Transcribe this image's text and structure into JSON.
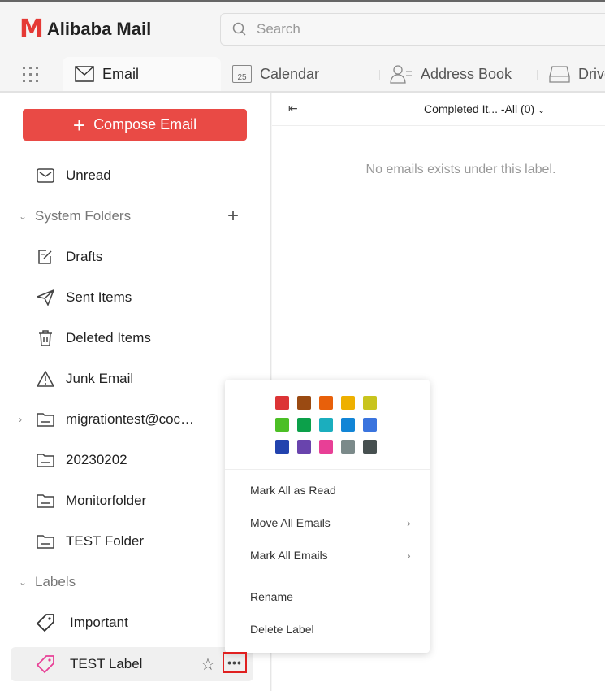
{
  "app": {
    "logo_mark": "M",
    "name": "Alibaba Mail"
  },
  "search": {
    "placeholder": "Search"
  },
  "tabs": [
    {
      "label": "Email"
    },
    {
      "label": "Calendar",
      "day": "25"
    },
    {
      "label": "Address Book"
    },
    {
      "label": "Drive"
    }
  ],
  "sidebar": {
    "compose": "Compose Email",
    "unread": "Unread",
    "system_folders": "System Folders",
    "folders": [
      "Drafts",
      "Sent Items",
      "Deleted Items",
      "Junk Email",
      "migrationtest@coc…",
      "20230202",
      "Monitorfolder",
      "TEST Folder"
    ],
    "labels_header": "Labels",
    "labels": [
      "Important",
      "TEST Label"
    ]
  },
  "main": {
    "filter": "Completed It... -All (0)",
    "empty": "No emails exists under this label."
  },
  "menu": {
    "colors": [
      "#dc3436",
      "#9a4a12",
      "#e8600a",
      "#eeb000",
      "#c8c41e",
      "#4cbf25",
      "#0ca04a",
      "#1baebe",
      "#1285d6",
      "#3a74de",
      "#2243ae",
      "#6944ad",
      "#e83f96",
      "#7b8a8a",
      "#475050"
    ],
    "items": [
      "Mark All as Read",
      "Move All Emails",
      "Mark All Emails",
      "Rename",
      "Delete Label"
    ]
  }
}
